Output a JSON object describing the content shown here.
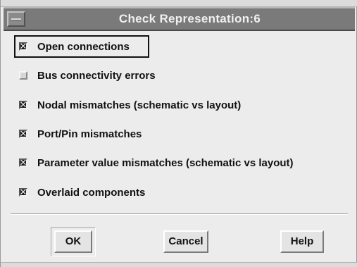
{
  "window": {
    "title": "Check Representation:6"
  },
  "options": [
    {
      "label": "Open connections",
      "checked": true,
      "focused": true
    },
    {
      "label": "Bus connectivity errors",
      "checked": false,
      "focused": false
    },
    {
      "label": "Nodal mismatches (schematic vs layout)",
      "checked": true,
      "focused": false
    },
    {
      "label": "Port/Pin mismatches",
      "checked": true,
      "focused": false
    },
    {
      "label": "Parameter value mismatches (schematic vs layout)",
      "checked": true,
      "focused": false
    },
    {
      "label": "Overlaid components",
      "checked": true,
      "focused": false
    }
  ],
  "buttons": {
    "ok_label": "OK",
    "cancel_label": "Cancel",
    "help_label": "Help"
  },
  "icons": {
    "window_menu": "window-menu-icon",
    "checkbox_mark": "x-mark-icon"
  },
  "colors": {
    "titlebar": "#7a7a7a",
    "dialog_background": "#ececec",
    "checked_box": "#1a1a1a"
  }
}
